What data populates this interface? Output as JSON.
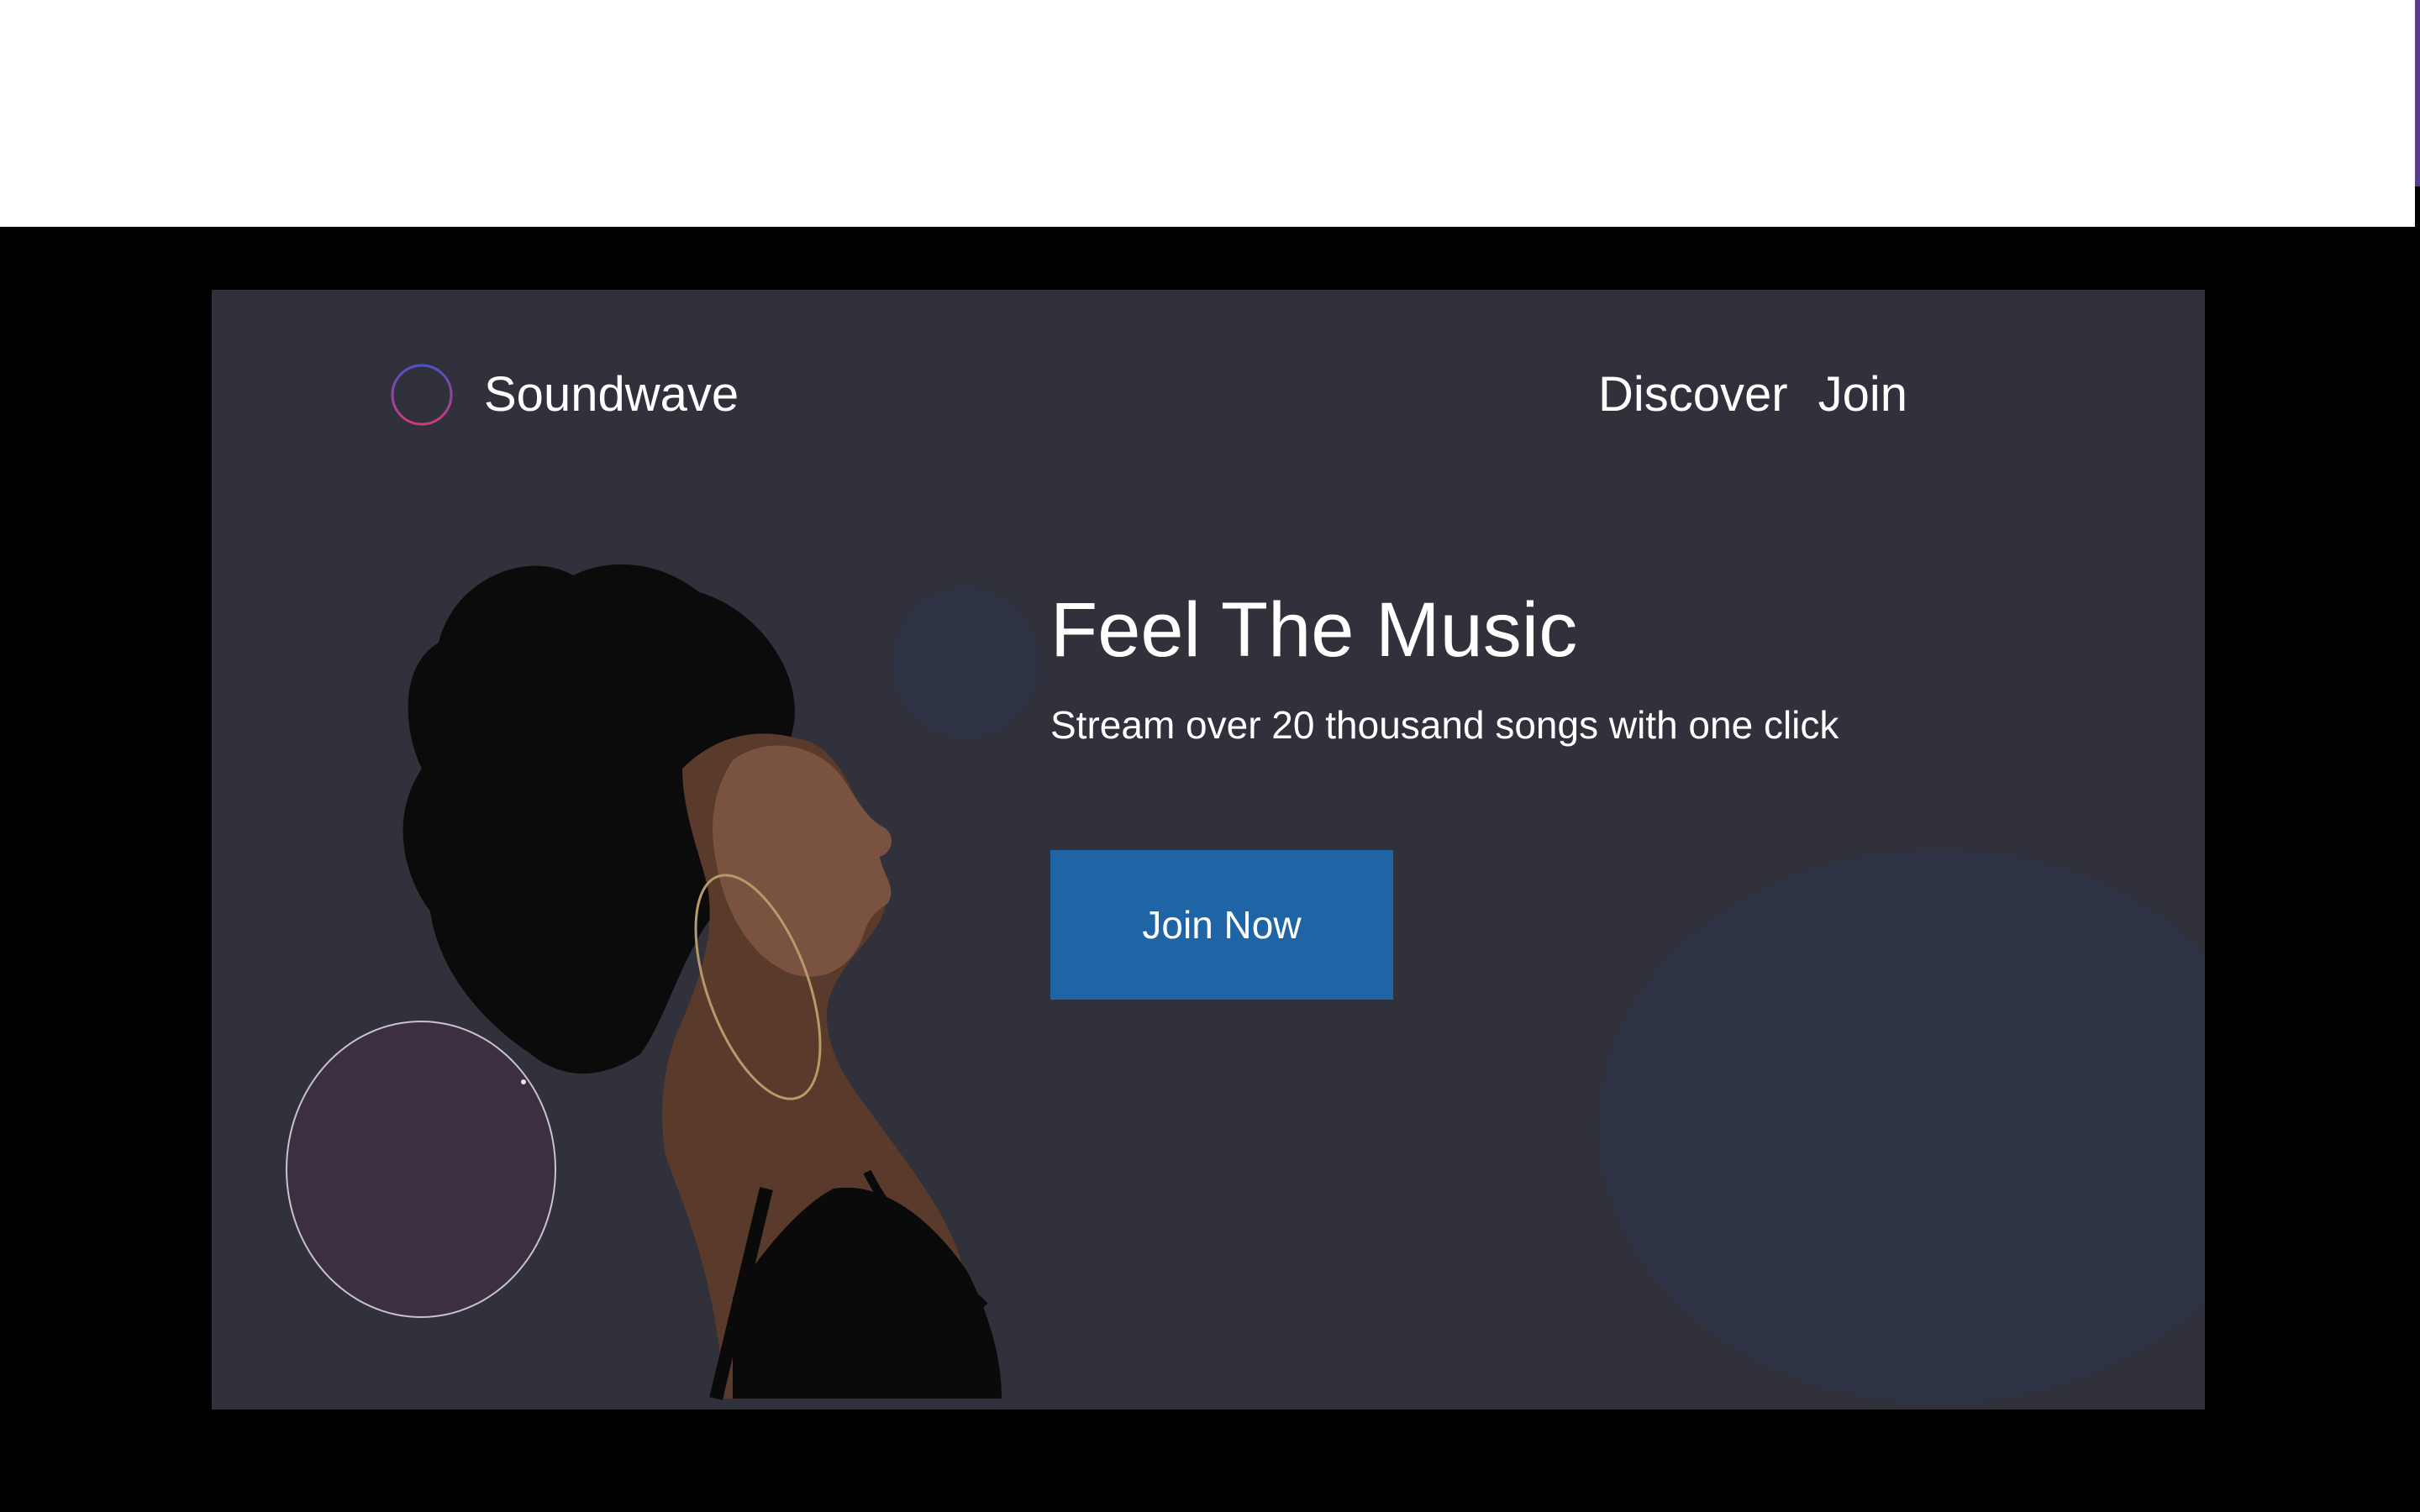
{
  "header": {
    "brand_name": "Soundwave",
    "logo_icon": "soundwave-logo-icon",
    "nav_items": [
      {
        "label": "Discover"
      },
      {
        "label": "Join"
      }
    ]
  },
  "hero": {
    "headline": "Feel The Music",
    "subheadline": "Stream over 20 thousand songs with one click",
    "cta_label": "Join Now",
    "image": "woman-with-headphones-profile"
  },
  "colors": {
    "background": "#000000",
    "card": "#31313b",
    "cta": "#1f65a6",
    "text": "#ffffff",
    "logo_gradient_start": "#4b55c8",
    "logo_gradient_end": "#d13a7a",
    "decor_blue": "#2d3344",
    "decor_purple": "#3c2f41"
  }
}
